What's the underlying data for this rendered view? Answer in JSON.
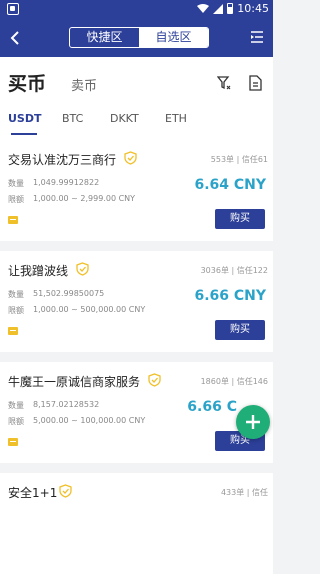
{
  "status": {
    "time": "10:45"
  },
  "nav": {
    "tabs": [
      {
        "label": "快捷区"
      },
      {
        "label": "自选区"
      }
    ]
  },
  "header": {
    "buy_title": "买币",
    "sell_title": "卖币"
  },
  "coin_tabs": [
    {
      "label": "USDT"
    },
    {
      "label": "BTC"
    },
    {
      "label": "DKKT"
    },
    {
      "label": "ETH"
    }
  ],
  "listings": [
    {
      "merchant": "交易认准沈万三商行",
      "trust": "553单 | 信任61",
      "qty_label": "数量",
      "qty": "1,049.99912822",
      "limit_label": "限额",
      "limit": "1,000.00 ~ 2,999.00 CNY",
      "price": "6.64 CNY",
      "button": "购买"
    },
    {
      "merchant": "让我蹭波线",
      "trust": "3036单 | 信任122",
      "qty_label": "数量",
      "qty": "51,502.99850075",
      "limit_label": "限额",
      "limit": "1,000.00 ~ 500,000.00 CNY",
      "price": "6.66 CNY",
      "button": "购买"
    },
    {
      "merchant": "牛魔王一原诚信商家服务",
      "trust": "1860单 | 信任146",
      "qty_label": "数量",
      "qty": "8,157.02128532",
      "limit_label": "限额",
      "limit": "5,000.00 ~ 100,000.00 CNY",
      "price": "6.66 C",
      "button": "购买"
    },
    {
      "merchant": "安全1+1",
      "trust": "433单 | 信任",
      "qty_label": "",
      "qty": "",
      "limit_label": "",
      "limit": "",
      "price": "",
      "button": ""
    }
  ],
  "colors": {
    "primary": "#2c3f99",
    "price": "#2ba3c9",
    "fab": "#1fae77",
    "verified": "#f0c02a"
  },
  "icons": {
    "back": "chevron-left-icon",
    "menu": "menu-icon",
    "filter": "filter-icon",
    "orders": "order-list-icon",
    "verified": "verified-badge-icon",
    "pay": "payment-method-icon",
    "fab": "plus-icon"
  }
}
